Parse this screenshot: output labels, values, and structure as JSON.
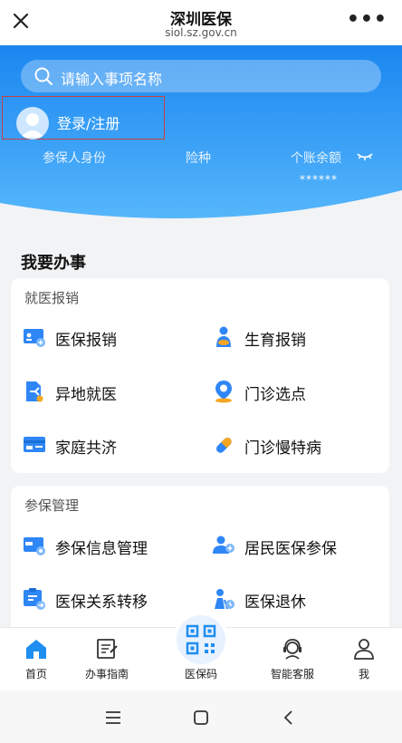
{
  "header": {
    "title": "深圳医保",
    "url": "siol.sz.gov.cn",
    "more": "•••"
  },
  "search": {
    "placeholder": "请输入事项名称"
  },
  "login": {
    "label": "登录/注册"
  },
  "metrics": {
    "identity": "参保人身份",
    "insurance": "险种",
    "balance_label": "个账余额",
    "balance_value": "******"
  },
  "section": {
    "title": "我要办事"
  },
  "groups": [
    {
      "title": "就医报销",
      "items": [
        {
          "label": "医保报销",
          "icon": "reimburse-card-icon"
        },
        {
          "label": "生育报销",
          "icon": "maternity-icon"
        },
        {
          "label": "异地就医",
          "icon": "remote-medical-icon"
        },
        {
          "label": "门诊选点",
          "icon": "clinic-location-icon"
        },
        {
          "label": "家庭共济",
          "icon": "family-card-icon"
        },
        {
          "label": "门诊慢特病",
          "icon": "pill-icon"
        }
      ]
    },
    {
      "title": "参保管理",
      "items": [
        {
          "label": "参保信息管理",
          "icon": "insurance-info-icon"
        },
        {
          "label": "居民医保参保",
          "icon": "resident-enroll-icon"
        },
        {
          "label": "医保关系转移",
          "icon": "transfer-icon"
        },
        {
          "label": "医保退休",
          "icon": "retirement-icon"
        }
      ]
    }
  ],
  "tabs": [
    {
      "label": "首页",
      "icon": "home-icon"
    },
    {
      "label": "办事指南",
      "icon": "guide-icon"
    },
    {
      "label": "医保码",
      "icon": "qr-code-icon"
    },
    {
      "label": "智能客服",
      "icon": "customer-service-icon"
    },
    {
      "label": "我",
      "icon": "profile-icon"
    }
  ],
  "colors": {
    "primary": "#1f8ef1",
    "icon_blue": "#2f86f6",
    "accent_orange": "#f6a623",
    "hero_top": "#1a86f0",
    "hero_bottom": "#55b6fb"
  }
}
